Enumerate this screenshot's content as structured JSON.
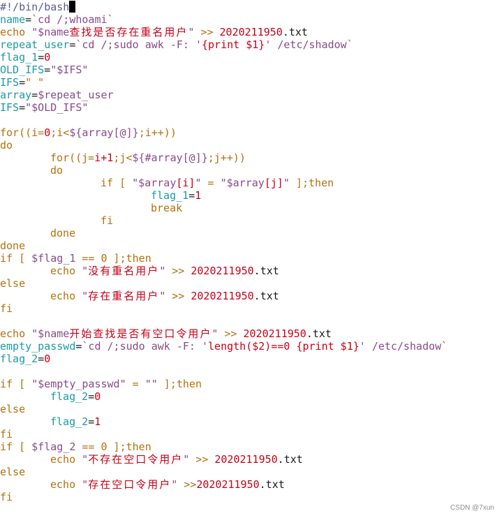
{
  "editor": {
    "cursor_line": 0,
    "lines": [
      [
        {
          "t": "comment",
          "v": "#!/bin/bash"
        }
      ],
      [
        {
          "t": "var",
          "v": "name"
        },
        {
          "t": "op",
          "v": "="
        },
        {
          "t": "cmd",
          "v": "`cd /;whoami`"
        }
      ],
      [
        {
          "t": "kw",
          "v": "echo "
        },
        {
          "t": "strv",
          "v": "\"$name"
        },
        {
          "t": "cjk",
          "v": "查找是否存在重名用户"
        },
        {
          "t": "strv",
          "v": "\""
        },
        {
          "t": "kw",
          "v": " >> "
        },
        {
          "t": "num",
          "v": "2020211950"
        },
        {
          "t": "plain",
          "v": ".txt"
        }
      ],
      [
        {
          "t": "var",
          "v": "repeat_user"
        },
        {
          "t": "op",
          "v": "="
        },
        {
          "t": "cmd",
          "v": "`cd /;sudo awk -F: '"
        },
        {
          "t": "str",
          "v": "{print $1}"
        },
        {
          "t": "cmd",
          "v": "' /etc/shadow`"
        }
      ],
      [
        {
          "t": "var",
          "v": "flag_1"
        },
        {
          "t": "op",
          "v": "="
        },
        {
          "t": "num",
          "v": "0"
        }
      ],
      [
        {
          "t": "var",
          "v": "OLD_IFS"
        },
        {
          "t": "op",
          "v": "="
        },
        {
          "t": "strv",
          "v": "\"$IFS\""
        }
      ],
      [
        {
          "t": "var",
          "v": "IFS"
        },
        {
          "t": "op",
          "v": "="
        },
        {
          "t": "kw",
          "v": "\" \""
        }
      ],
      [
        {
          "t": "var",
          "v": "array"
        },
        {
          "t": "op",
          "v": "="
        },
        {
          "t": "cmd",
          "v": "$repeat_user"
        }
      ],
      [
        {
          "t": "var",
          "v": "IFS"
        },
        {
          "t": "op",
          "v": "="
        },
        {
          "t": "strv",
          "v": "\"$OLD_IFS\""
        }
      ],
      [],
      [
        {
          "t": "kw",
          "v": "for((i="
        },
        {
          "t": "num",
          "v": "0"
        },
        {
          "t": "kw",
          "v": ";i<"
        },
        {
          "t": "strv",
          "v": "${array[@]}"
        },
        {
          "t": "kw",
          "v": ";i++))"
        }
      ],
      [
        {
          "t": "kw",
          "v": "do"
        }
      ],
      [
        {
          "t": "plain",
          "v": "\t"
        },
        {
          "t": "kw",
          "v": "for((j="
        },
        {
          "t": "num",
          "v": "i+1"
        },
        {
          "t": "kw",
          "v": ";j<"
        },
        {
          "t": "strv",
          "v": "${#array[@]}"
        },
        {
          "t": "kw",
          "v": ";j++))"
        }
      ],
      [
        {
          "t": "plain",
          "v": "\t"
        },
        {
          "t": "kw",
          "v": "do"
        }
      ],
      [
        {
          "t": "plain",
          "v": "\t\t"
        },
        {
          "t": "kw",
          "v": "if [ "
        },
        {
          "t": "strv",
          "v": "\"$array"
        },
        {
          "t": "str",
          "v": "[i]"
        },
        {
          "t": "strv",
          "v": "\""
        },
        {
          "t": "kw",
          "v": " = "
        },
        {
          "t": "strv",
          "v": "\"$array"
        },
        {
          "t": "str",
          "v": "[j]"
        },
        {
          "t": "strv",
          "v": "\""
        },
        {
          "t": "kw",
          "v": " ];then"
        }
      ],
      [
        {
          "t": "plain",
          "v": "\t\t\t"
        },
        {
          "t": "var",
          "v": "flag_1"
        },
        {
          "t": "op",
          "v": "="
        },
        {
          "t": "num",
          "v": "1"
        }
      ],
      [
        {
          "t": "plain",
          "v": "\t\t\t"
        },
        {
          "t": "kw",
          "v": "break"
        }
      ],
      [
        {
          "t": "plain",
          "v": "\t\t"
        },
        {
          "t": "kw",
          "v": "fi"
        }
      ],
      [
        {
          "t": "plain",
          "v": "\t"
        },
        {
          "t": "kw",
          "v": "done"
        }
      ],
      [
        {
          "t": "kw",
          "v": "done"
        }
      ],
      [
        {
          "t": "kw",
          "v": "if [ "
        },
        {
          "t": "strv",
          "v": "$flag_1"
        },
        {
          "t": "kw",
          "v": " == 0 ];then"
        }
      ],
      [
        {
          "t": "plain",
          "v": "\t"
        },
        {
          "t": "kw",
          "v": "echo "
        },
        {
          "t": "strv",
          "v": "\""
        },
        {
          "t": "cjk",
          "v": "没有重名用户"
        },
        {
          "t": "strv",
          "v": "\""
        },
        {
          "t": "kw",
          "v": " >> "
        },
        {
          "t": "num",
          "v": "2020211950"
        },
        {
          "t": "plain",
          "v": ".txt"
        }
      ],
      [
        {
          "t": "kw",
          "v": "else"
        }
      ],
      [
        {
          "t": "plain",
          "v": "\t"
        },
        {
          "t": "kw",
          "v": "echo "
        },
        {
          "t": "strv",
          "v": "\""
        },
        {
          "t": "cjk",
          "v": "存在重名用户"
        },
        {
          "t": "strv",
          "v": "\""
        },
        {
          "t": "kw",
          "v": " >> "
        },
        {
          "t": "num",
          "v": "2020211950"
        },
        {
          "t": "plain",
          "v": ".txt"
        }
      ],
      [
        {
          "t": "kw",
          "v": "fi"
        }
      ],
      [],
      [
        {
          "t": "kw",
          "v": "echo "
        },
        {
          "t": "strv",
          "v": "\"$name"
        },
        {
          "t": "cjk",
          "v": "开始查找是否有空口令用户"
        },
        {
          "t": "strv",
          "v": "\""
        },
        {
          "t": "kw",
          "v": " >> "
        },
        {
          "t": "num",
          "v": "2020211950"
        },
        {
          "t": "plain",
          "v": ".txt"
        }
      ],
      [
        {
          "t": "var",
          "v": "empty_passwd"
        },
        {
          "t": "op",
          "v": "="
        },
        {
          "t": "cmd",
          "v": "`cd /;sudo awk -F: '"
        },
        {
          "t": "str",
          "v": "length($2)==0 {print $1}"
        },
        {
          "t": "cmd",
          "v": "' /etc/shadow`"
        }
      ],
      [
        {
          "t": "var",
          "v": "flag_2"
        },
        {
          "t": "op",
          "v": "="
        },
        {
          "t": "num",
          "v": "0"
        }
      ],
      [],
      [
        {
          "t": "kw",
          "v": "if [ "
        },
        {
          "t": "strv",
          "v": "\"$empty_passwd\""
        },
        {
          "t": "kw",
          "v": " = "
        },
        {
          "t": "strv",
          "v": "\"\""
        },
        {
          "t": "kw",
          "v": " ];then"
        }
      ],
      [
        {
          "t": "plain",
          "v": "\t"
        },
        {
          "t": "var",
          "v": "flag_2"
        },
        {
          "t": "op",
          "v": "="
        },
        {
          "t": "num",
          "v": "0"
        }
      ],
      [
        {
          "t": "kw",
          "v": "else"
        }
      ],
      [
        {
          "t": "plain",
          "v": "\t"
        },
        {
          "t": "var",
          "v": "flag_2"
        },
        {
          "t": "op",
          "v": "="
        },
        {
          "t": "num",
          "v": "1"
        }
      ],
      [
        {
          "t": "kw",
          "v": "fi"
        }
      ],
      [
        {
          "t": "kw",
          "v": "if [ "
        },
        {
          "t": "strv",
          "v": "$flag_2"
        },
        {
          "t": "kw",
          "v": " == 0 ];then"
        }
      ],
      [
        {
          "t": "plain",
          "v": "\t"
        },
        {
          "t": "kw",
          "v": "echo "
        },
        {
          "t": "strv",
          "v": "\""
        },
        {
          "t": "cjk",
          "v": "不存在空口令用户"
        },
        {
          "t": "strv",
          "v": "\""
        },
        {
          "t": "kw",
          "v": " >> "
        },
        {
          "t": "num",
          "v": "2020211950"
        },
        {
          "t": "plain",
          "v": ".txt"
        }
      ],
      [
        {
          "t": "kw",
          "v": "else"
        }
      ],
      [
        {
          "t": "plain",
          "v": "\t"
        },
        {
          "t": "kw",
          "v": "echo "
        },
        {
          "t": "strv",
          "v": "\""
        },
        {
          "t": "cjk",
          "v": "存在空口令用户"
        },
        {
          "t": "strv",
          "v": "\""
        },
        {
          "t": "kw",
          "v": " >>"
        },
        {
          "t": "num",
          "v": "2020211950"
        },
        {
          "t": "plain",
          "v": ".txt"
        }
      ],
      [
        {
          "t": "kw",
          "v": "fi"
        }
      ]
    ]
  },
  "watermark": "CSDN @7xun",
  "colors": {
    "background": "#ffffff",
    "comment": "#5b5b9a",
    "variable": "#1c9aa6",
    "keyword": "#b5700d",
    "string": "#c70016",
    "string_var": "#8a4a8a",
    "number": "#c70016",
    "cursor": "#000000"
  }
}
